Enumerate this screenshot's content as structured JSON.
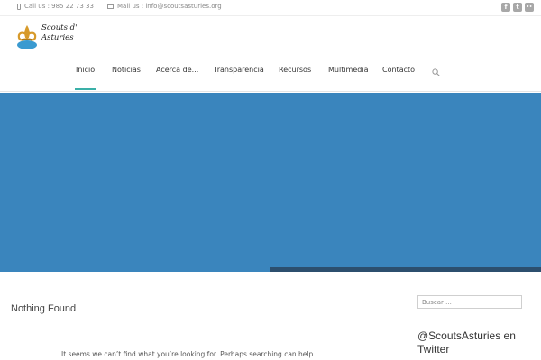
{
  "topbar": {
    "phone_text": "Call us : 985 22 73 33",
    "mail_text": "Mail us : info@scoutsasturies.org",
    "social_icons": [
      "facebook-icon",
      "twitter-icon",
      "flickr-icon"
    ],
    "social_glyphs": [
      "f",
      "t",
      "••"
    ]
  },
  "header": {
    "logo_line1": "Scouts d'",
    "logo_line2": "Asturies"
  },
  "nav": {
    "items": [
      {
        "label": "Inicio",
        "active": true
      },
      {
        "label": "Noticias",
        "active": false
      },
      {
        "label": "Acerca de...",
        "active": false
      },
      {
        "label": "Transparencia",
        "active": false
      },
      {
        "label": "Recursos",
        "active": false
      },
      {
        "label": "Multimedia",
        "active": false
      },
      {
        "label": "Contacto",
        "active": false
      }
    ],
    "accent_color": "#3ab0a8"
  },
  "hero": {
    "background_color": "#3a85bd",
    "bar_color": "#2c4f6e"
  },
  "main": {
    "title": "Nothing Found",
    "message": "It seems we can’t find what you’re looking for. Perhaps searching can help."
  },
  "sidebar": {
    "search_placeholder": "Buscar ...",
    "twitter_heading": "@ScoutsAsturies en Twitter"
  }
}
